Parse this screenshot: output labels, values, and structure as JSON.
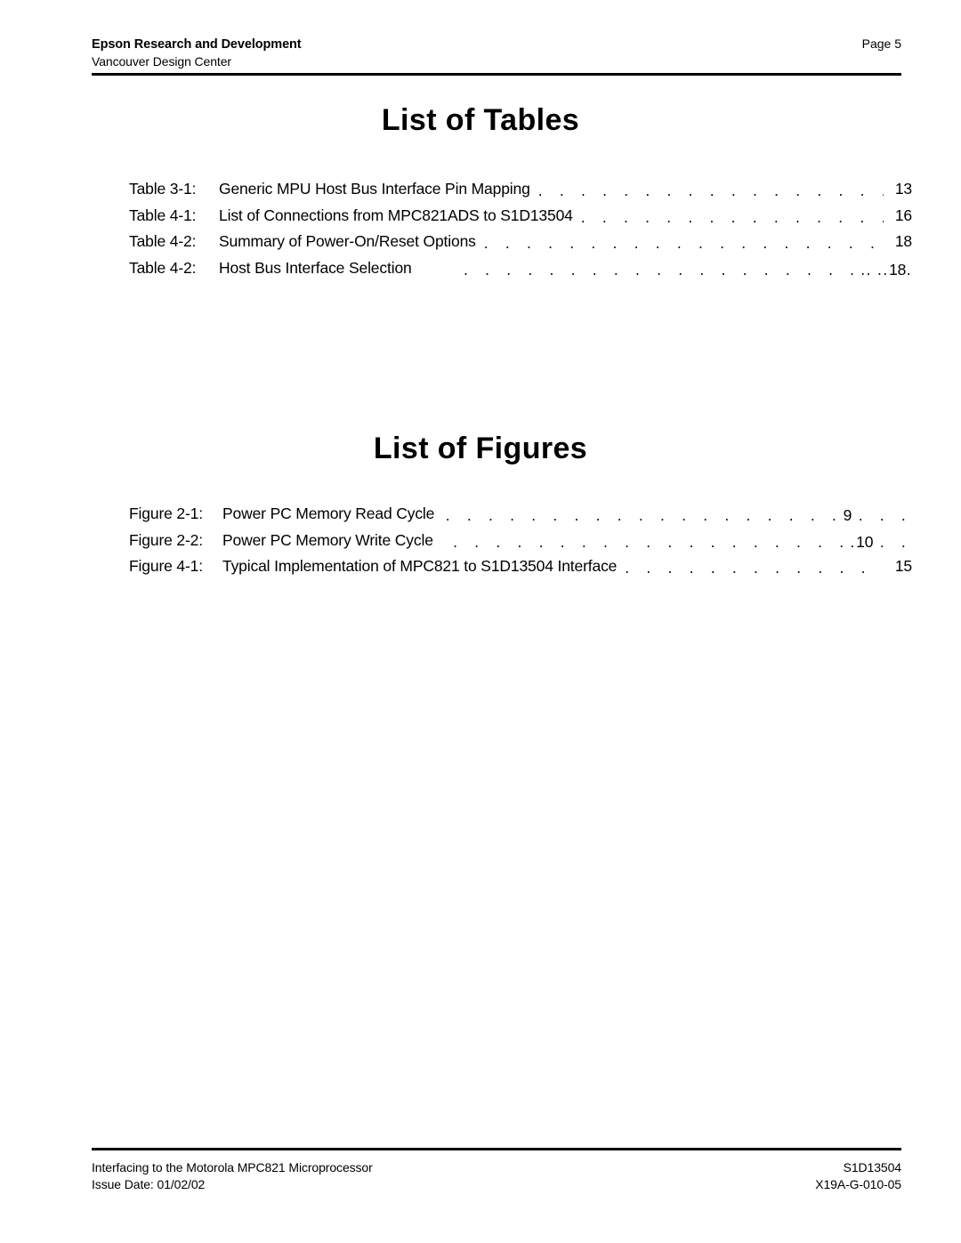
{
  "header": {
    "company": "Epson Research and Development",
    "division": "Vancouver Design Center",
    "page_label": "Page 5"
  },
  "sections": {
    "tables": {
      "title": "List of Tables",
      "entries": [
        {
          "label": "Table 3-1:",
          "caption": "Generic MPU Host Bus Interface Pin Mapping",
          "page": "13",
          "leader_style": "right-aligned",
          "leader_dots": ". . . . . . . . . . . . . . . . . ."
        },
        {
          "label": "Table 4-1:",
          "caption": "List of Connections from MPC821ADS to S1D13504",
          "page": "16",
          "leader_style": "right-aligned",
          "leader_dots": ". . . . . . . . . . . . . . . ."
        },
        {
          "label": "Table 4-2:",
          "caption": "Summary of Power-On/Reset Options",
          "page": "18",
          "leader_style": "right-aligned",
          "leader_dots": ". . . . . . . . . . . . . . . . . . . . . . ."
        },
        {
          "label": "Table 4-2:",
          "caption": "Host Bus Interface Selection",
          "page": "18",
          "leader_style": "embedded",
          "leader_pre_dots": ". . . . . . . . . . . . . . . . . . .",
          "leader_tight_dots": ".. ..",
          "leader_post_dots": "."
        }
      ]
    },
    "figures": {
      "title": "List of Figures",
      "entries": [
        {
          "label": "Figure 2-1:",
          "caption": "Power PC Memory Read Cycle",
          "page": "9",
          "leader_style": "embedded",
          "leader_pre_dots": ". . . . . . . . . . . . . . . . . . . . . .",
          "leader_tight_dots": "",
          "leader_post_dots": ". . ."
        },
        {
          "label": "Figure 2-2:",
          "caption": "Power PC Memory Write Cycle",
          "page": "10",
          "leader_style": "embedded",
          "leader_pre_dots": ". . . . . . . . . . . . . . . . . . . . . .",
          "leader_tight_dots": ".",
          "leader_post_dots": ". ."
        },
        {
          "label": "Figure 4-1:",
          "caption": "Typical Implementation of MPC821 to S1D13504 Interface",
          "page": "15",
          "leader_style": "right-aligned",
          "leader_dots": ". . . . . . . . . . . . ."
        }
      ]
    }
  },
  "footer": {
    "document_title": "Interfacing to the Motorola MPC821 Microprocessor",
    "issue_date": "Issue Date: 01/02/02",
    "product_code": "S1D13504",
    "doc_number": "X19A-G-010-05"
  }
}
